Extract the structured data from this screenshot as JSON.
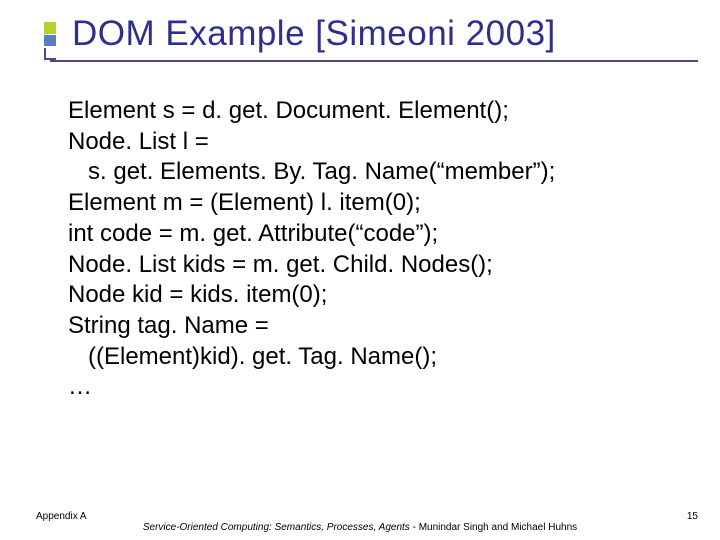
{
  "title": "DOM Example [Simeoni 2003]",
  "code_lines": [
    "Element s = d. get. Document. Element();",
    "Node. List l =",
    "   s. get. Elements. By. Tag. Name(“member”);",
    "Element m = (Element) l. item(0);",
    "int code = m. get. Attribute(“code”);",
    "Node. List kids = m. get. Child. Nodes();",
    "Node kid = kids. item(0);",
    "String tag. Name =",
    "   ((Element)kid). get. Tag. Name();",
    "…"
  ],
  "footer": {
    "left": "Appendix A",
    "center_italic": "Service-Oriented Computing: Semantics, Processes, Agents",
    "center_tail": " - Munindar Singh and Michael Huhns",
    "page": "15"
  }
}
